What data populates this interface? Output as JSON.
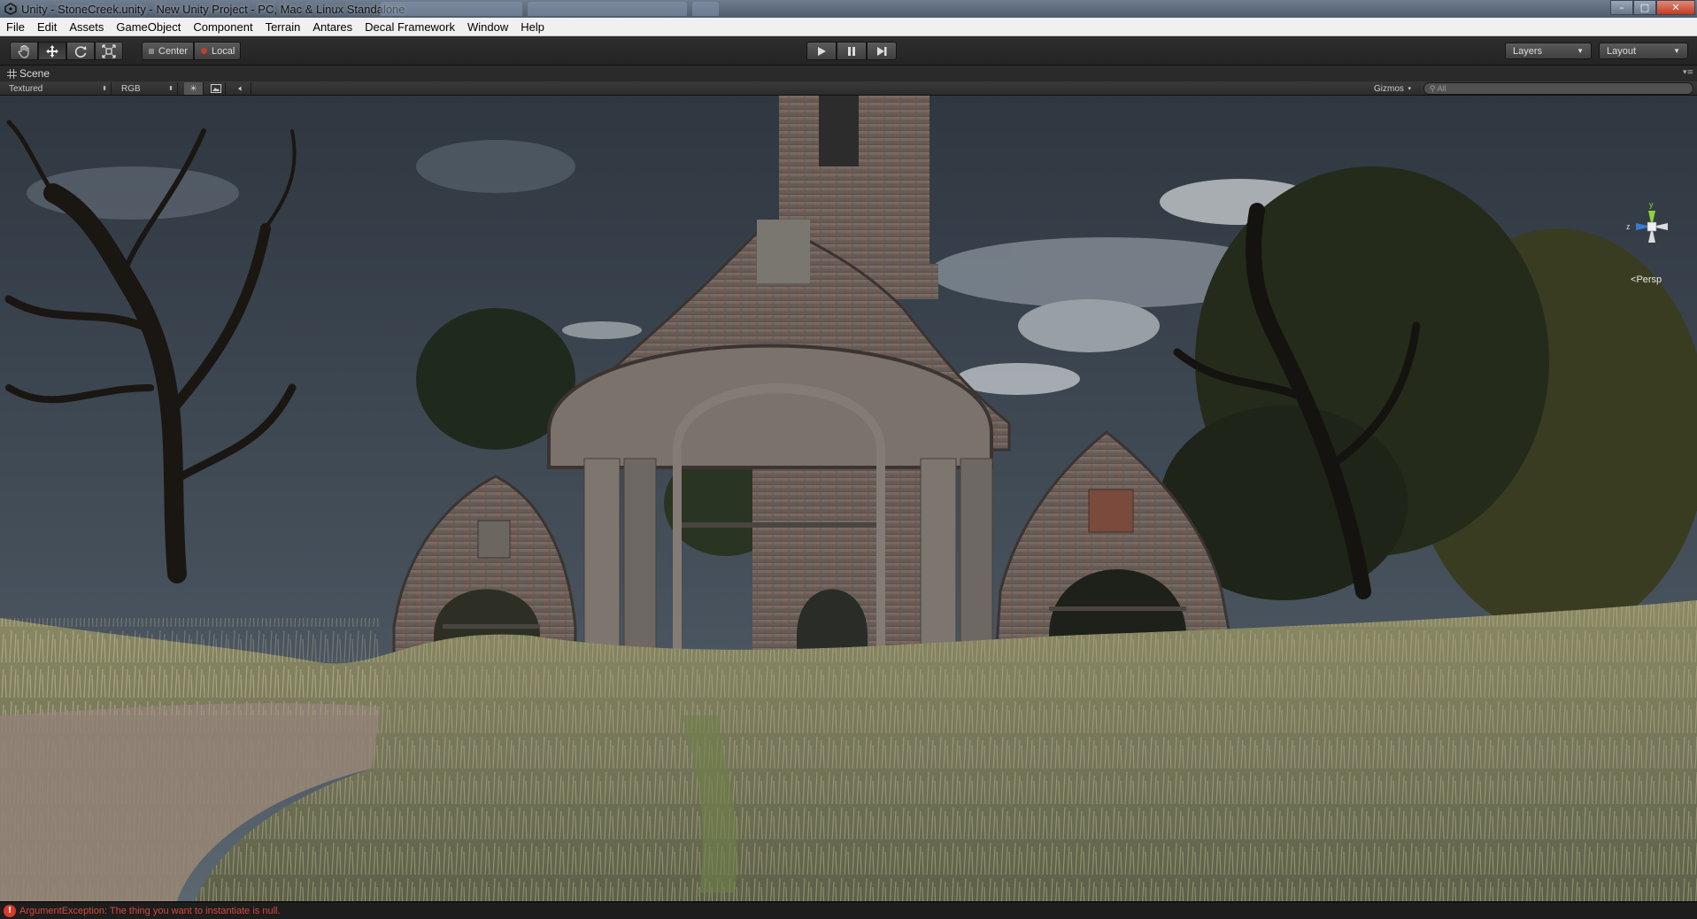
{
  "window": {
    "title": "Unity - StoneCreek.unity - New Unity Project - PC, Mac & Linux Standalone",
    "controls": {
      "minimize": "–",
      "maximize": "□",
      "close": "✕"
    }
  },
  "menu": [
    "File",
    "Edit",
    "Assets",
    "GameObject",
    "Component",
    "Terrain",
    "Antares",
    "Decal Framework",
    "Window",
    "Help"
  ],
  "toolbar": {
    "transform_tools": [
      "hand-icon",
      "move-icon",
      "rotate-icon",
      "scale-icon"
    ],
    "active_tool": "move-icon",
    "pivot_mode": "Center",
    "pivot_rotation": "Local",
    "layers_label": "Layers",
    "layout_label": "Layout"
  },
  "scene_tab": {
    "label": "Scene"
  },
  "scene_toolbar": {
    "draw_mode": "Textured",
    "render_mode": "RGB",
    "gizmos_label": "Gizmos",
    "search_placeholder": "All"
  },
  "viewport": {
    "projection": "Persp",
    "axis_label_z": "z",
    "axis_label_y": "y"
  },
  "status": {
    "error_icon": "!",
    "message": "ArgumentException: The thing you want to instantiate is null."
  },
  "colors": {
    "error": "#d84a3a",
    "axis_y": "#8ed43a",
    "axis_z": "#3a7ad8",
    "toolbar_bg": "#2a2a2a"
  }
}
